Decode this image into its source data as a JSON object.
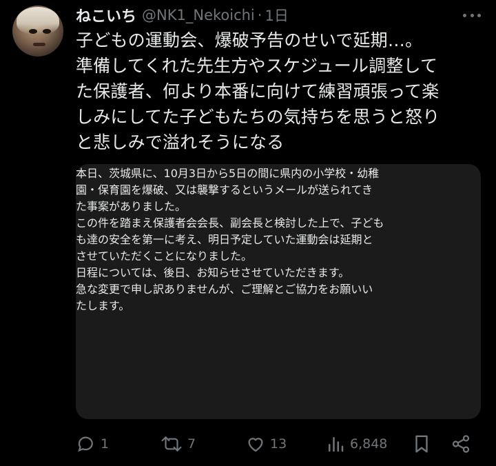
{
  "author": {
    "display_name": "ねこいち",
    "handle": "@NK1_Nekoichi",
    "separator": "·",
    "time": "1日"
  },
  "tweet": {
    "lines": [
      "子どもの運動会、爆破予告のせいで延期…。",
      "準備してくれた先生方やスケジュール調整して",
      "た保護者、何より本番に向けて練習頑張って楽",
      "しみにしてた子どもたちの気持ちを思うと怒り",
      "と悲しみで溢れそうになる"
    ]
  },
  "card": {
    "paragraphs": [
      [
        "本日、茨城県に、10月3日から5日の間に県内の小学校・幼稚",
        "園・保育園を爆破、又は襲撃するというメールが送られてき",
        "た事案がありました。"
      ],
      [
        "この件を踏まえ保護者会会長、副会長と検討した上で、子ども",
        "も達の安全を第一に考え、明日予定していた運動会は延期と",
        "させていただくことになりました。"
      ],
      [
        "日程については、後日、お知らせさせていただきます。"
      ],
      [
        "急な変更で申し訳ありませんが、ご理解とご協力をお願いい",
        "たします。"
      ]
    ]
  },
  "actions": {
    "replies": "1",
    "reposts": "7",
    "likes": "13",
    "views": "6,848"
  },
  "icons": {
    "more": "more-icon",
    "reply": "reply-icon",
    "repost": "repost-icon",
    "like": "heart-icon",
    "views": "views-icon",
    "bookmark": "bookmark-icon",
    "share": "share-icon"
  },
  "colors": {
    "background": "#000000",
    "text": "#e7e9ea",
    "secondary": "#71767b",
    "card": "#1b1b1b"
  }
}
